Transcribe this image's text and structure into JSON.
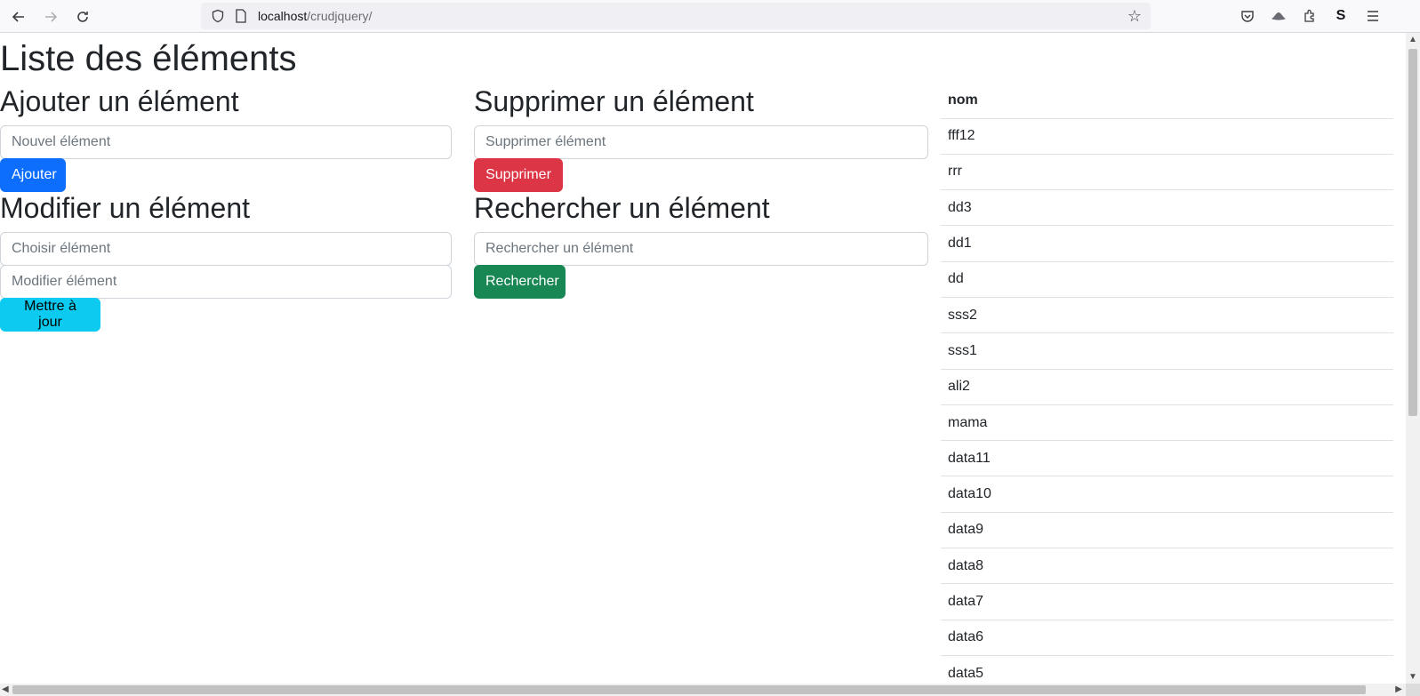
{
  "browser": {
    "back_icon": "arrow-left-icon",
    "forward_icon": "arrow-right-icon",
    "reload_icon": "reload-icon",
    "url_host": "localhost",
    "url_path": "/crudjquery/"
  },
  "page": {
    "title": "Liste des éléments",
    "add": {
      "heading": "Ajouter un élément",
      "placeholder": "Nouvel élément",
      "button": "Ajouter"
    },
    "delete": {
      "heading": "Supprimer un élément",
      "placeholder": "Supprimer élément",
      "button": "Supprimer"
    },
    "edit": {
      "heading": "Modifier un élément",
      "choose_placeholder": "Choisir élément",
      "new_value_placeholder": "Modifier élément",
      "button": "Mettre à jour"
    },
    "search": {
      "heading": "Rechercher un élément",
      "placeholder": "Rechercher un élément",
      "button": "Rechercher"
    }
  },
  "table": {
    "header": "nom",
    "rows": [
      "fff12",
      "rrr",
      "dd3",
      "dd1",
      "dd",
      "sss2",
      "sss1",
      "ali2",
      "mama",
      "data11",
      "data10",
      "data9",
      "data8",
      "data7",
      "data6",
      "data5"
    ]
  },
  "colors": {
    "primary": "#0d6efd",
    "danger": "#dc3545",
    "info": "#0dcaf0",
    "success": "#198754"
  }
}
